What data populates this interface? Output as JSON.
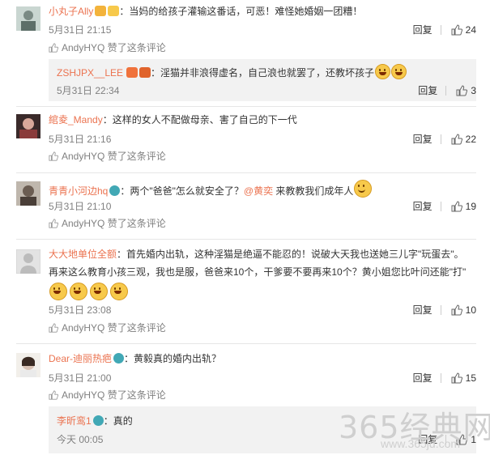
{
  "comments": [
    {
      "username": "小丸子Ally",
      "text": "：当妈的给孩子灌输这番话，可恶！难怪她婚姻一团糟！",
      "time": "5月31日 21:15",
      "reply_label": "回复",
      "like_count": "24",
      "liked_by": "AndyHYQ 赞了这条评论",
      "sub_reply": {
        "username": "ZSHJPX__LEE",
        "text": "：淫猫并非浪得虚名，自己浪也就罢了，还教坏孩子",
        "time": "5月31日 22:34",
        "reply_label": "回复",
        "like_count": "3"
      }
    },
    {
      "username": "綰夌_Mandy",
      "text": "：这样的女人不配做母亲、害了自己的下一代",
      "time": "5月31日 21:16",
      "reply_label": "回复",
      "like_count": "22",
      "liked_by": "AndyHYQ 赞了这条评论"
    },
    {
      "username": "青青小河边hq",
      "text_pre": "：两个\"爸爸\"怎么就安全了？",
      "mention": "@黄奕",
      "text_post": " 来教教我们成年人",
      "time": "5月31日 21:10",
      "reply_label": "回复",
      "like_count": "19",
      "liked_by": "AndyHYQ 赞了这条评论"
    },
    {
      "username": "大大地单位全额",
      "text": "：首先婚内出轨，这种淫猫是绝逼不能忍的！说破大天我也送她三儿字\"玩蛋去\"。",
      "text2": "再来这么教育小孩三观，我也是服，爸爸来10个，干爹要不要再来10个？黄小姐您比叶问还能\"打\"",
      "time": "5月31日 23:08",
      "reply_label": "回复",
      "like_count": "10",
      "liked_by": "AndyHYQ 赞了这条评论"
    },
    {
      "username": "Dear-迪丽热疤",
      "text": "：黄毅真的婚内出轨？",
      "time": "5月31日 21:00",
      "reply_label": "回复",
      "like_count": "15",
      "liked_by": "AndyHYQ 赞了这条评论",
      "sub_reply": {
        "username": "李昕鸾1",
        "text": "：真的",
        "time": "今天 00:05",
        "reply_label": "回复",
        "like_count": "1"
      }
    }
  ],
  "watermark": {
    "text": "365经典网",
    "url": "www.365jd.com"
  },
  "colors": {
    "accent": "#eb7350",
    "meta": "#808080"
  }
}
